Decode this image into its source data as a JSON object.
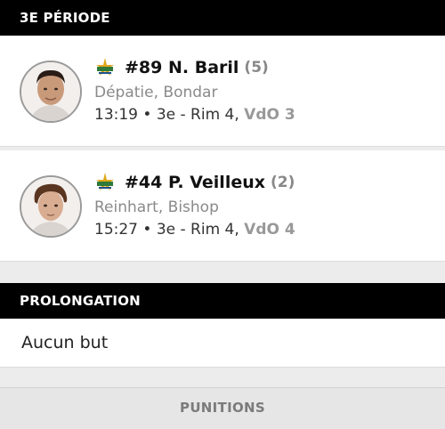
{
  "period3": {
    "header": "3E PÉRIODE",
    "goals": [
      {
        "scorer": "#89 N. Baril",
        "count": "(5)",
        "assists": "Dépatie, Bondar",
        "detail": "13:19 • 3e - Rim 4, ",
        "team_score": "VdO 3",
        "icon": "team-logo-icon"
      },
      {
        "scorer": "#44 P. Veilleux",
        "count": "(2)",
        "assists": "Reinhart, Bishop",
        "detail": "15:27 • 3e - Rim 4, ",
        "team_score": "VdO 4",
        "icon": "team-logo-icon"
      }
    ]
  },
  "overtime": {
    "header": "PROLONGATION",
    "message": "Aucun but"
  },
  "penalties": {
    "label": "PUNITIONS"
  },
  "colors": {
    "header_bg": "#000000",
    "muted": "#888888",
    "team_score": "#999999"
  }
}
